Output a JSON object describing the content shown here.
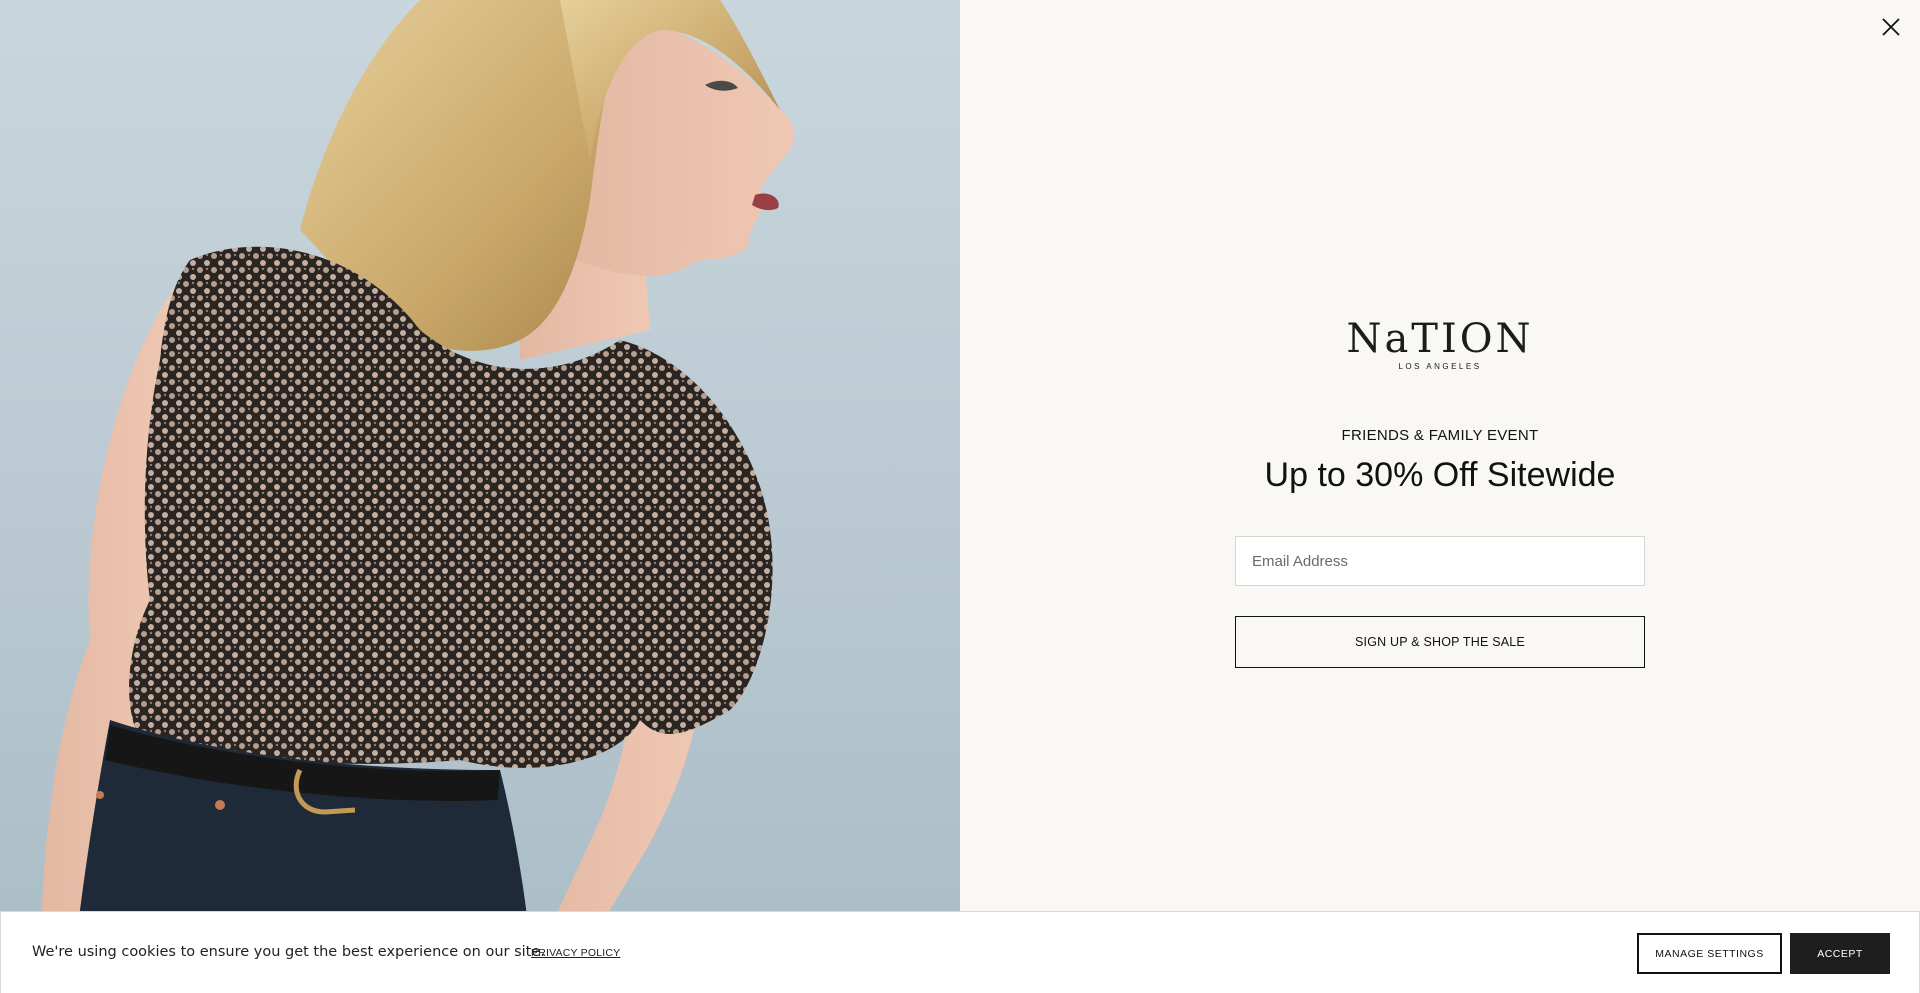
{
  "popup": {
    "brand": {
      "wordmark": "NaTION",
      "tagline": "LOS ANGELES"
    },
    "eyebrow": "FRIENDS & FAMILY EVENT",
    "headline": "Up to 30% Off Sitewide",
    "email": {
      "placeholder": "Email Address",
      "value": ""
    },
    "submit_label": "SIGN UP & SHOP THE SALE",
    "close_icon": "close-icon"
  },
  "cookie_bar": {
    "message": "We're using cookies to ensure you get the best experience on our site.",
    "privacy_link": "PRIVACY POLICY",
    "manage_label": "MANAGE SETTINGS",
    "accept_label": "ACCEPT"
  },
  "colors": {
    "panel_background": "#f9f8f5",
    "photo_background": "#c3d1d8",
    "text": "#111111",
    "accept_button": "#1e1e1e"
  }
}
